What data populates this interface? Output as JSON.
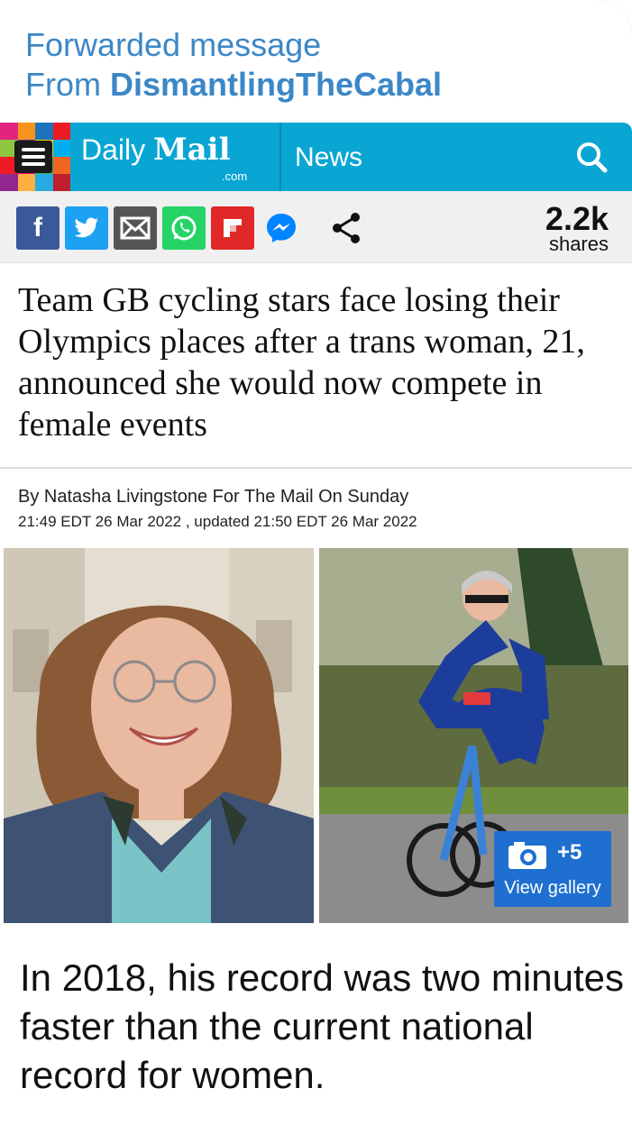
{
  "forward": {
    "line1": "Forwarded message",
    "from_prefix": "From ",
    "from_name": "DismantlingTheCabal"
  },
  "header": {
    "brand_daily": "Daily",
    "brand_mail": "Mail",
    "brand_com": ".com",
    "section": "News",
    "accent": "#0aa6d3"
  },
  "share_bar": {
    "icons": [
      "facebook-icon",
      "twitter-icon",
      "email-icon",
      "whatsapp-icon",
      "flipboard-icon",
      "messenger-icon",
      "share-icon"
    ],
    "count": "2.2k",
    "count_label": "shares"
  },
  "article": {
    "headline": "Team GB cycling stars face losing their Olympics places after a trans woman, 21, announced she would now compete in female events",
    "byline": "By Natasha Livingstone For The Mail On Sunday",
    "timestamp": "21:49 EDT 26 Mar 2022 , updated 21:50 EDT 26 Mar 2022"
  },
  "gallery": {
    "count": "+5",
    "label": "View gallery"
  },
  "caption": "In 2018, his record was two minutes faster than the current national record for women."
}
